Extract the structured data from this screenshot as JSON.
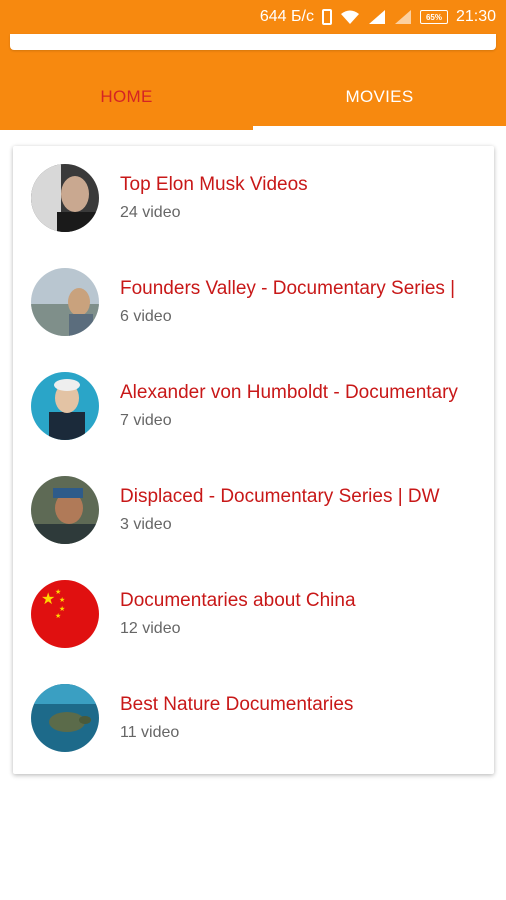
{
  "status_bar": {
    "network_speed": "644 Б/с",
    "battery": "65%",
    "time": "21:30"
  },
  "tabs": [
    {
      "label": "HOME",
      "active": false
    },
    {
      "label": "MOVIES",
      "active": true
    }
  ],
  "playlists": [
    {
      "title": "Top Elon Musk Videos",
      "count": "24 video",
      "thumb_icon": "elon-musk-thumbnail"
    },
    {
      "title": "Founders Valley - Documentary Series |",
      "count": "6 video",
      "thumb_icon": "founders-valley-thumbnail"
    },
    {
      "title": "Alexander von Humboldt - Documentary",
      "count": "7 video",
      "thumb_icon": "humboldt-thumbnail"
    },
    {
      "title": "Displaced - Documentary Series | DW",
      "count": "3 video",
      "thumb_icon": "displaced-thumbnail"
    },
    {
      "title": "Documentaries about China",
      "count": "12 video",
      "thumb_icon": "china-flag-thumbnail"
    },
    {
      "title": "Best Nature Documentaries",
      "count": "11 video",
      "thumb_icon": "nature-turtle-thumbnail"
    }
  ],
  "colors": {
    "header": "#f7890f",
    "accent_text": "#c81818",
    "tab_active": "#ffffff",
    "tab_inactive": "#d42424"
  }
}
